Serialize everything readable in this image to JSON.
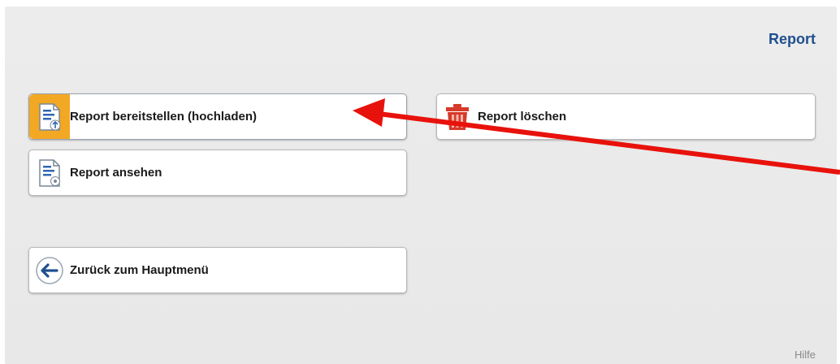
{
  "header": {
    "title": "Report"
  },
  "menu": {
    "upload": {
      "label": "Report bereitstellen (hochladen)",
      "icon": "document-upload-icon"
    },
    "delete": {
      "label": "Report löschen",
      "icon": "trash-icon"
    },
    "view": {
      "label": "Report ansehen",
      "icon": "document-view-icon"
    },
    "back": {
      "label": "Zurück zum Hauptmenü",
      "icon": "arrow-left-circle-icon"
    }
  },
  "footer": {
    "help_label": "Hilfe"
  },
  "colors": {
    "title": "#1f4f8f",
    "highlight": "#f3a823",
    "annotation_arrow": "#e8120c",
    "trash": "#d63a2a"
  }
}
